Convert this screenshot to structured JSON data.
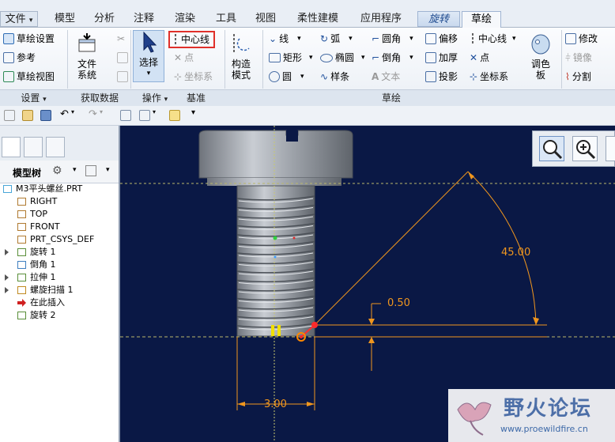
{
  "tabs": [
    {
      "label": "文件",
      "type": "file"
    },
    {
      "label": "模型"
    },
    {
      "label": "分析"
    },
    {
      "label": "注释"
    },
    {
      "label": "渲染"
    },
    {
      "label": "工具"
    },
    {
      "label": "视图"
    },
    {
      "label": "柔性建模"
    },
    {
      "label": "应用程序"
    },
    {
      "label": "旋转",
      "type": "ctx"
    },
    {
      "label": "草绘",
      "type": "active"
    }
  ],
  "ribbon": {
    "setup": {
      "sketch_setup": "草绘设置",
      "reference": "参考",
      "sketch_view": "草绘视图"
    },
    "get_data": {
      "file_system": "文件系统"
    },
    "operations": {
      "select": "选择"
    },
    "datum": {
      "centerline": "中心线",
      "point": "点",
      "coord_sys": "坐标系"
    },
    "build_mode": "构造模式",
    "sketch": {
      "line": "线",
      "rectangle": "矩形",
      "circle": "圆",
      "arc": "弧",
      "ellipse": "椭圆",
      "spline": "样条",
      "fillet": "圆角",
      "chamfer": "倒角",
      "text": "文本",
      "offset": "偏移",
      "thicken": "加厚",
      "project": "投影",
      "centerline": "中心线",
      "point": "点",
      "coord_sys": "坐标系"
    },
    "palette": "调色板",
    "edit": {
      "modify": "修改",
      "mirror": "镜像",
      "divide": "分割"
    },
    "groups": {
      "setup": "设置",
      "get_data": "获取数据",
      "operations": "操作",
      "datum": "基准",
      "sketch": "草绘"
    }
  },
  "panel": {
    "title": "模型树",
    "tree": [
      {
        "label": "M3平头螺丝.PRT",
        "icon": "part",
        "indent": 0,
        "expand": false
      },
      {
        "label": "RIGHT",
        "icon": "plane",
        "indent": 1,
        "expand": false
      },
      {
        "label": "TOP",
        "icon": "plane",
        "indent": 1,
        "expand": false
      },
      {
        "label": "FRONT",
        "icon": "plane",
        "indent": 1,
        "expand": false
      },
      {
        "label": "PRT_CSYS_DEF",
        "icon": "csys",
        "indent": 1,
        "expand": false
      },
      {
        "label": "旋转 1",
        "icon": "revolve",
        "indent": 1,
        "expand": true
      },
      {
        "label": "倒角 1",
        "icon": "chamfer",
        "indent": 1,
        "expand": false
      },
      {
        "label": "拉伸 1",
        "icon": "extrude",
        "indent": 1,
        "expand": true
      },
      {
        "label": "螺旋扫描 1",
        "icon": "helical",
        "indent": 1,
        "expand": true
      },
      {
        "label": "在此插入",
        "icon": "insert",
        "indent": 1,
        "expand": false
      },
      {
        "label": "旋转 2",
        "icon": "revolve2",
        "indent": 1,
        "expand": false
      }
    ]
  },
  "canvas": {
    "dims": {
      "angle": "45.00",
      "small": "0.50",
      "width": "3.00"
    },
    "colors": {
      "bg": "#0a1845",
      "dim": "#f0961e",
      "centerline": "#c8c870",
      "thread": "#b7bcc5"
    }
  },
  "watermark": {
    "title": "野火论坛",
    "url": "www.proewildfire.cn"
  }
}
